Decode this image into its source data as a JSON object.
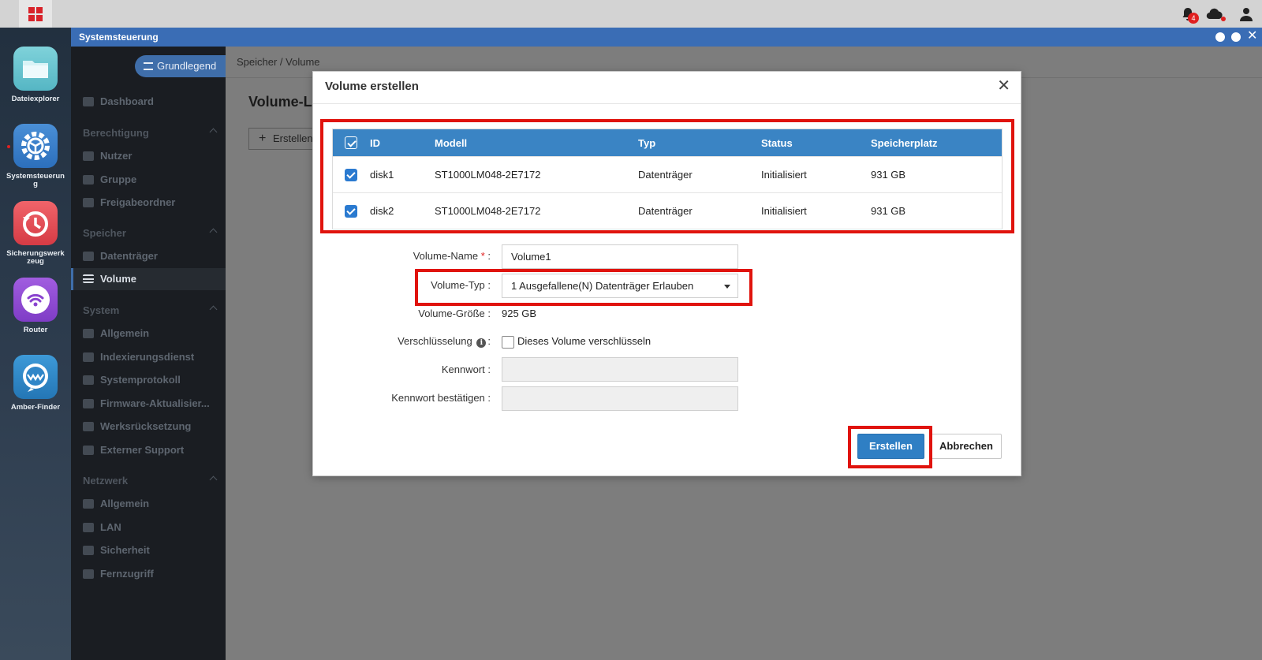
{
  "taskbar": {
    "start_icon": "grid-app-icon",
    "notification_count": "4",
    "icons": [
      "bell-icon",
      "cloud-icon",
      "user-icon"
    ]
  },
  "dock": {
    "items": [
      {
        "label": "Dateiexplorer",
        "icon": "folder-icon"
      },
      {
        "label": "Systemsteuerung",
        "icon": "gear-icon"
      },
      {
        "label": "Sicherungswerkzeug",
        "icon": "backup-clock-icon"
      },
      {
        "label": "Router",
        "icon": "wifi-icon"
      },
      {
        "label": "Amber-Finder",
        "icon": "finder-icon"
      }
    ]
  },
  "window": {
    "title": "Systemsteuerung"
  },
  "sidebar": {
    "mode_label": "Grundlegend",
    "dashboard": "Dashboard",
    "sections": [
      {
        "title": "Berechtigung",
        "items": [
          "Nutzer",
          "Gruppe",
          "Freigabeordner"
        ]
      },
      {
        "title": "Speicher",
        "items": [
          "Datenträger",
          "Volume"
        ]
      },
      {
        "title": "System",
        "items": [
          "Allgemein",
          "Indexierungsdienst",
          "Systemprotokoll",
          "Firmware-Aktualisier...",
          "Werksrücksetzung",
          "Externer Support"
        ]
      },
      {
        "title": "Netzwerk",
        "items": [
          "Allgemein",
          "LAN",
          "Sicherheit",
          "Fernzugriff"
        ]
      }
    ],
    "active_item": "Volume"
  },
  "content": {
    "breadcrumb": "Speicher / Volume",
    "page_title": "Volume-L",
    "create_button": "Erstellen"
  },
  "modal": {
    "title": "Volume erstellen",
    "table": {
      "columns": [
        "ID",
        "Modell",
        "Typ",
        "Status",
        "Speicherplatz"
      ],
      "rows": [
        {
          "checked": true,
          "id": "disk1",
          "model": "ST1000LM048-2E7172",
          "type": "Datenträger",
          "status": "Initialisiert",
          "size": "931 GB"
        },
        {
          "checked": true,
          "id": "disk2",
          "model": "ST1000LM048-2E7172",
          "type": "Datenträger",
          "status": "Initialisiert",
          "size": "931 GB"
        }
      ]
    },
    "form": {
      "volume_name_label": "Volume-Name",
      "volume_name_value": "Volume1",
      "volume_type_label": "Volume-Typ :",
      "volume_type_value": "1 Ausgefallene(N) Datenträger Erlauben",
      "volume_size_label": "Volume-Größe :",
      "volume_size_value": "925 GB",
      "encryption_label": "Verschlüsselung",
      "encryption_checkbox_label": "Dieses Volume verschlüsseln",
      "encryption_checked": false,
      "password_label": "Kennwort :",
      "password_confirm_label": "Kennwort bestätigen :"
    },
    "buttons": {
      "create": "Erstellen",
      "cancel": "Abbrechen"
    }
  },
  "colors": {
    "accent": "#3a6db5",
    "table_header": "#3a84c4",
    "highlight": "#e0130d"
  }
}
